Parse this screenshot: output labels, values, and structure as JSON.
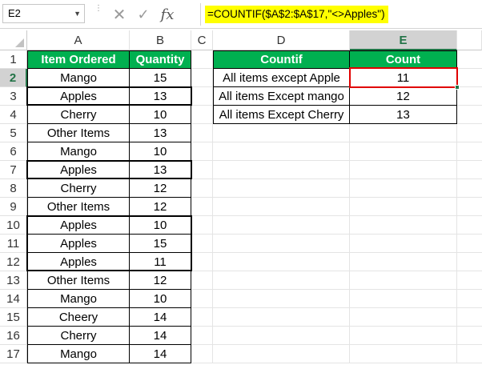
{
  "formula_bar": {
    "name_box": "E2",
    "cancel_icon": "✕",
    "enter_icon": "✓",
    "fx_label": "fx",
    "formula": "=COUNTIF($A$2:$A$17,\"<>Apples\")",
    "highlight_color": "#ffff00"
  },
  "columns": [
    "A",
    "B",
    "C",
    "D",
    "E"
  ],
  "selected_column": "E",
  "selected_row": "2",
  "rows": [
    "1",
    "2",
    "3",
    "4",
    "5",
    "6",
    "7",
    "8",
    "9",
    "10",
    "11",
    "12",
    "13",
    "14",
    "15",
    "16",
    "17"
  ],
  "table_left": {
    "headers": {
      "item": "Item Ordered",
      "quantity": "Quantity"
    },
    "rows": [
      {
        "item": "Mango",
        "quantity": "15"
      },
      {
        "item": "Apples",
        "quantity": "13"
      },
      {
        "item": "Cherry",
        "quantity": "10"
      },
      {
        "item": "Other Items",
        "quantity": "13"
      },
      {
        "item": "Mango",
        "quantity": "10"
      },
      {
        "item": "Apples",
        "quantity": "13"
      },
      {
        "item": "Cherry",
        "quantity": "12"
      },
      {
        "item": "Other Items",
        "quantity": "12"
      },
      {
        "item": "Apples",
        "quantity": "10"
      },
      {
        "item": "Apples",
        "quantity": "15"
      },
      {
        "item": "Apples",
        "quantity": "11"
      },
      {
        "item": "Other Items",
        "quantity": "12"
      },
      {
        "item": "Mango",
        "quantity": "10"
      },
      {
        "item": "Cheery",
        "quantity": "14"
      },
      {
        "item": "Cherry",
        "quantity": "14"
      },
      {
        "item": "Mango",
        "quantity": "14"
      }
    ]
  },
  "table_right": {
    "headers": {
      "countif": "Countif",
      "count": "Count"
    },
    "rows": [
      {
        "label": "All items except Apple",
        "count": "11"
      },
      {
        "label": "All items Except mango",
        "count": "12"
      },
      {
        "label": "All items Except Cherry",
        "count": "13"
      }
    ]
  },
  "colors": {
    "header_fill": "#00b050",
    "header_text": "#ffffff",
    "active_cell_border": "#e00000",
    "selection_accent": "#217346"
  }
}
